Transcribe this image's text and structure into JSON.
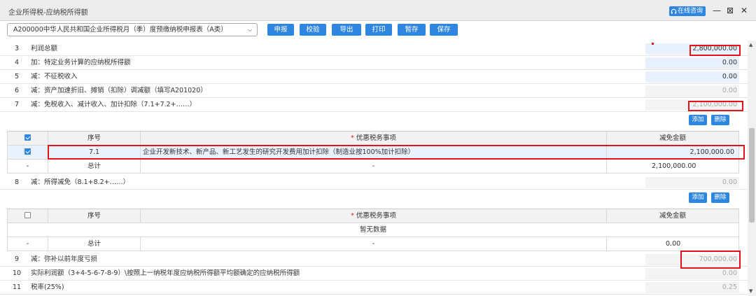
{
  "window": {
    "title": "企业所得税-应纳税所得额",
    "online_label": "在线咨询",
    "minimize": "—",
    "restore": "⊠",
    "close": "✕"
  },
  "toolbar": {
    "form_select": "A200000中华人民共和国企业所得税月（季）度预缴纳税申报表（A类）",
    "buttons": [
      "申报",
      "校验",
      "导出",
      "打印",
      "暂存",
      "保存"
    ]
  },
  "rows": [
    {
      "num": "3",
      "label": "利润总额",
      "value": "2,800,000.00"
    },
    {
      "num": "4",
      "label": "加：特定业务计算的应纳税所得额",
      "value": "0.00"
    },
    {
      "num": "5",
      "label": "减：不征税收入",
      "value": "0.00"
    },
    {
      "num": "6",
      "label": "减：资产加速折旧、摊销（扣除）调减额（填写A201020）",
      "value": "0.00"
    },
    {
      "num": "7",
      "label": "减：免税收入、减计收入、加计扣除（7.1+7.2+……）",
      "value": "2,100,000.00"
    },
    {
      "num": "8",
      "label": "减：所得减免（8.1+8.2+……）",
      "value": "0.00"
    },
    {
      "num": "9",
      "label": "减：弥补以前年度亏损",
      "value": "700,000.00"
    },
    {
      "num": "10",
      "label": "实际利润额（3+4-5-6-7-8-9）\\按照上一纳税年度应纳税所得额平均额确定的应纳税所得额",
      "value": "0.00"
    },
    {
      "num": "11",
      "label": "税率(25%)",
      "value": "0.25"
    }
  ],
  "sub_tables": {
    "add_label": "添加",
    "delete_label": "删除",
    "col_seq": "序号",
    "col_required": "*",
    "col_item": "优惠税务事项",
    "col_amount": "减免金额",
    "total_label": "总计",
    "dash": "-",
    "t7": {
      "items": [
        {
          "seq": "7.1",
          "item": "企业开发新技术、新产品、新工艺发生的研究开发费用加计扣除（制造业按100%加计扣除）",
          "amount": "2,100,000.00"
        }
      ],
      "total": "2,100,000.00"
    },
    "t8": {
      "empty": "暂无数据",
      "total": "0.00"
    }
  }
}
